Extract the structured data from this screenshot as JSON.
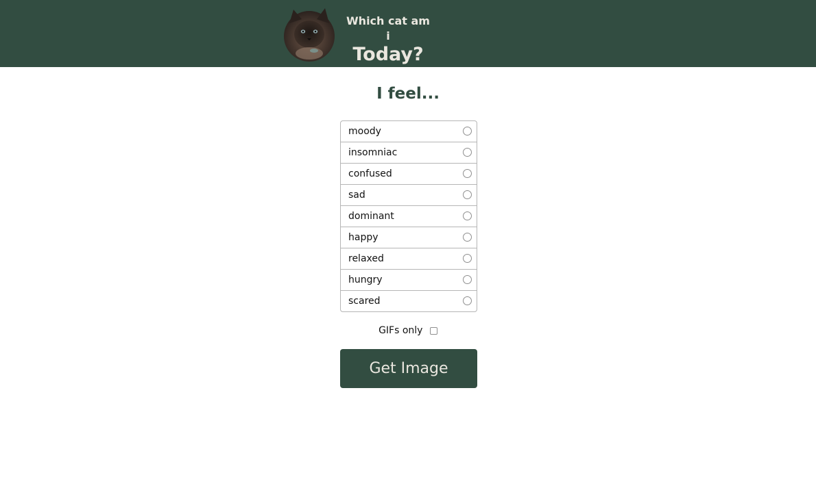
{
  "header": {
    "logo_icon": "cat-photo-icon",
    "title_line1": "Which cat am i",
    "title_line2": "Today?",
    "background_color": "#324d41",
    "text_color": "#eae7df"
  },
  "main": {
    "heading": "I feel...",
    "moods": [
      {
        "label": "moody",
        "selected": false
      },
      {
        "label": "insomniac",
        "selected": false
      },
      {
        "label": "confused",
        "selected": false
      },
      {
        "label": "sad",
        "selected": false
      },
      {
        "label": "dominant",
        "selected": false
      },
      {
        "label": "happy",
        "selected": false
      },
      {
        "label": "relaxed",
        "selected": false
      },
      {
        "label": "hungry",
        "selected": false
      },
      {
        "label": "scared",
        "selected": false
      }
    ],
    "gifs_only_label": "GIFs only",
    "gifs_only_checked": false,
    "submit_label": "Get Image",
    "accent_color": "#324d41"
  }
}
